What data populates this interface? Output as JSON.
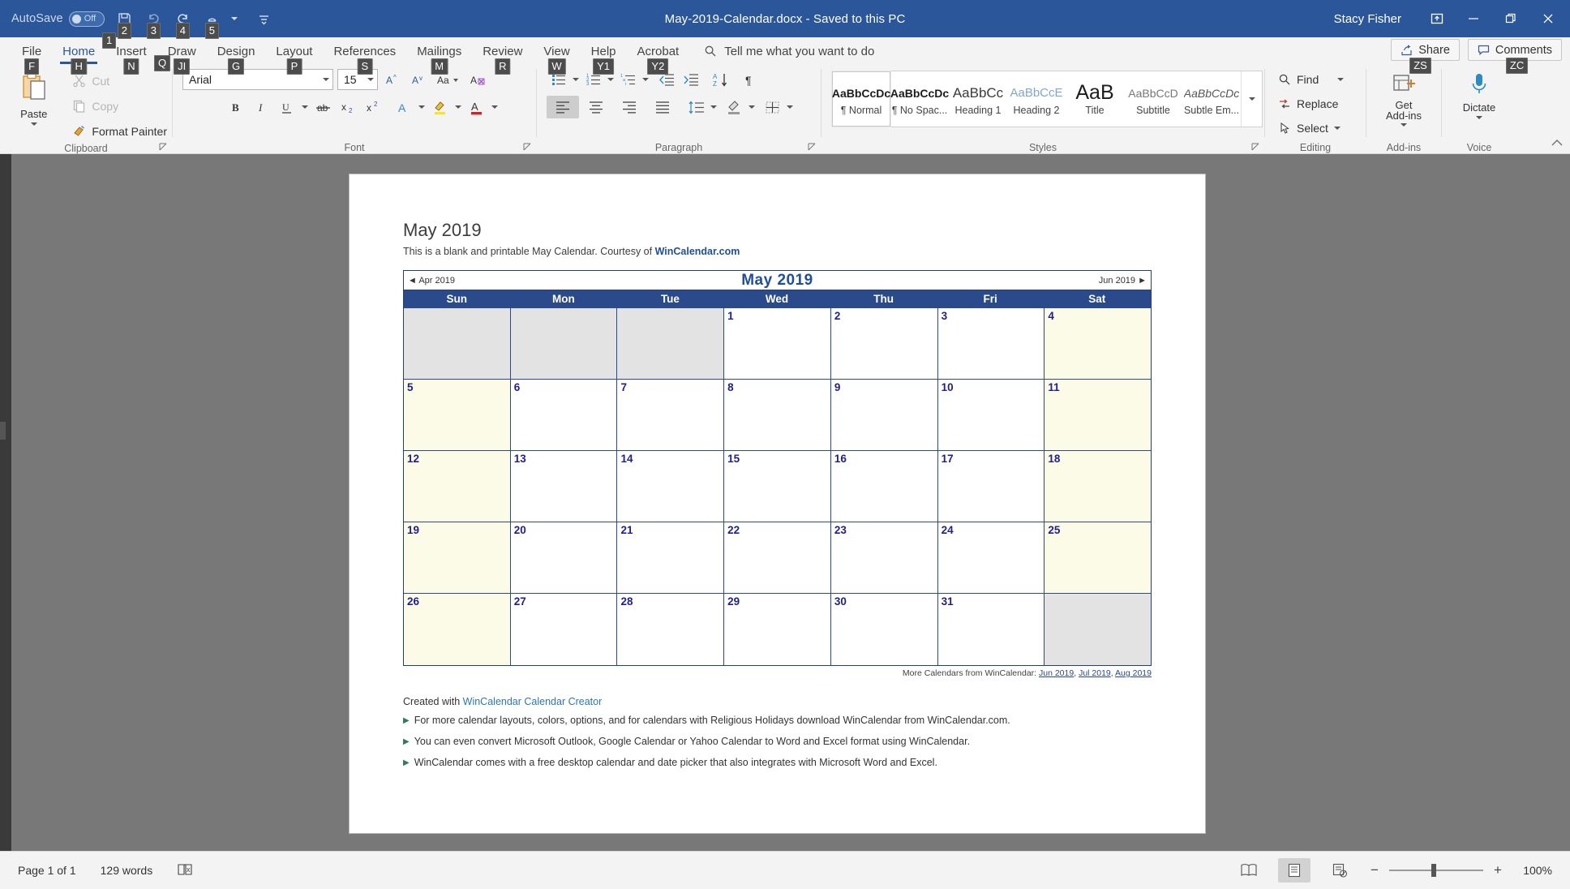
{
  "titlebar": {
    "autosave_label": "AutoSave",
    "autosave_state": "Off",
    "document_title": "May-2019-Calendar.docx  -  Saved to this PC",
    "user_name": "Stacy Fisher",
    "quick_access": [
      {
        "name": "autosave-toggle",
        "keytip": "1"
      },
      {
        "name": "save-button",
        "keytip": "2"
      },
      {
        "name": "undo-button",
        "keytip": "3"
      },
      {
        "name": "redo-button",
        "keytip": "4"
      },
      {
        "name": "touch-mode-button",
        "keytip": "5"
      },
      {
        "name": "customize-quick-access-toolbar",
        "keytip": ""
      }
    ],
    "window_controls": [
      "ribbon-display-options",
      "minimize",
      "restore",
      "close"
    ]
  },
  "tabs": [
    {
      "label": "File",
      "keytip": "F",
      "active": false
    },
    {
      "label": "Home",
      "keytip": "H",
      "active": true
    },
    {
      "label": "Insert",
      "keytip": "N",
      "active": false
    },
    {
      "label": "Draw",
      "keytip": "JI",
      "active": false
    },
    {
      "label": "Design",
      "keytip": "G",
      "active": false
    },
    {
      "label": "Layout",
      "keytip": "P",
      "active": false
    },
    {
      "label": "References",
      "keytip": "S",
      "active": false
    },
    {
      "label": "Mailings",
      "keytip": "M",
      "active": false
    },
    {
      "label": "Review",
      "keytip": "R",
      "active": false
    },
    {
      "label": "View",
      "keytip": "W",
      "active": false
    },
    {
      "label": "Help",
      "keytip": "Y1",
      "active": false
    },
    {
      "label": "Acrobat",
      "keytip": "Y2",
      "active": false
    }
  ],
  "tellme": {
    "placeholder": "Tell me what you want to do",
    "keytip": "Q"
  },
  "share": {
    "label": "Share",
    "keytip": "ZS"
  },
  "comments": {
    "label": "Comments",
    "keytip": "ZC"
  },
  "ribbon": {
    "clipboard": {
      "group_label": "Clipboard",
      "paste_label": "Paste",
      "cut_label": "Cut",
      "copy_label": "Copy",
      "format_painter_label": "Format Painter"
    },
    "font": {
      "group_label": "Font",
      "font_name": "Arial",
      "font_size": "15",
      "buttons": [
        "grow-font",
        "shrink-font",
        "change-case",
        "clear-formatting",
        "bold",
        "italic",
        "underline",
        "strikethrough",
        "subscript",
        "superscript",
        "text-effects",
        "text-highlight-color",
        "font-color"
      ]
    },
    "paragraph": {
      "group_label": "Paragraph",
      "buttons": [
        "bullets",
        "numbering",
        "multilevel-list",
        "decrease-indent",
        "increase-indent",
        "sort",
        "show-formatting-marks",
        "align-left",
        "center",
        "align-right",
        "justify",
        "line-spacing",
        "shading",
        "borders"
      ],
      "active": "align-left"
    },
    "styles": {
      "group_label": "Styles",
      "items": [
        {
          "preview": "AaBbCcDc",
          "name": "¶ Normal",
          "selected": true
        },
        {
          "preview": "AaBbCcDc",
          "name": "¶ No Spac...",
          "selected": false
        },
        {
          "preview": "AaBbCc",
          "name": "Heading 1",
          "selected": false
        },
        {
          "preview": "AaBbCcE",
          "name": "Heading 2",
          "selected": false
        },
        {
          "preview": "AaB",
          "name": "Title",
          "selected": false
        },
        {
          "preview": "AaBbCcD",
          "name": "Subtitle",
          "selected": false
        },
        {
          "preview": "AaBbCcDc",
          "name": "Subtle Em...",
          "selected": false
        }
      ]
    },
    "editing": {
      "group_label": "Editing",
      "find_label": "Find",
      "replace_label": "Replace",
      "select_label": "Select"
    },
    "addins": {
      "group_label": "Add-ins",
      "get_addins_label": "Get\nAdd-ins"
    },
    "voice": {
      "group_label": "Voice",
      "dictate_label": "Dictate"
    }
  },
  "document": {
    "heading": "May 2019",
    "subtitle_before": "This is a blank and printable May Calendar.  Courtesy of ",
    "subtitle_link": "WinCalendar.com",
    "calendar": {
      "prev_label": "◄ Apr 2019",
      "title": "May  2019",
      "next_label": "Jun 2019 ►",
      "day_headers": [
        "Sun",
        "Mon",
        "Tue",
        "Wed",
        "Thu",
        "Fri",
        "Sat"
      ],
      "weeks": [
        [
          "",
          "",
          "",
          "1",
          "2",
          "3",
          "4"
        ],
        [
          "5",
          "6",
          "7",
          "8",
          "9",
          "10",
          "11"
        ],
        [
          "12",
          "13",
          "14",
          "15",
          "16",
          "17",
          "18"
        ],
        [
          "19",
          "20",
          "21",
          "22",
          "23",
          "24",
          "25"
        ],
        [
          "26",
          "27",
          "28",
          "29",
          "30",
          "31",
          ""
        ]
      ]
    },
    "more_calendars_label": "More Calendars from WinCalendar:",
    "more_calendars_links": [
      "Jun 2019",
      "Jul 2019",
      "Aug 2019"
    ],
    "created_with_prefix": "Created with ",
    "created_with_link": "WinCalendar Calendar Creator",
    "bullets": [
      "For more calendar layouts, colors, options, and for calendars with Religious Holidays download WinCalendar from WinCalendar.com.",
      "You can even convert Microsoft Outlook, Google Calendar or Yahoo Calendar to Word and Excel format using WinCalendar.",
      "WinCalendar comes with a free desktop calendar and date picker that also integrates with Microsoft Word and Excel."
    ]
  },
  "statusbar": {
    "page_label": "Page 1 of 1",
    "word_count": "129 words",
    "proofing_icon": "proofing-errors-icon",
    "views": [
      "read-mode",
      "print-layout",
      "web-layout"
    ],
    "active_view": "print-layout",
    "zoom_level": "100%"
  },
  "colors": {
    "title_bar": "#2b579a",
    "accent": "#2b579a",
    "calendar_header": "#2a4a8b",
    "weekend_fill": "#fbfbe8",
    "blank_fill": "#e3e3e3",
    "day_number": "#1f1f8f"
  }
}
